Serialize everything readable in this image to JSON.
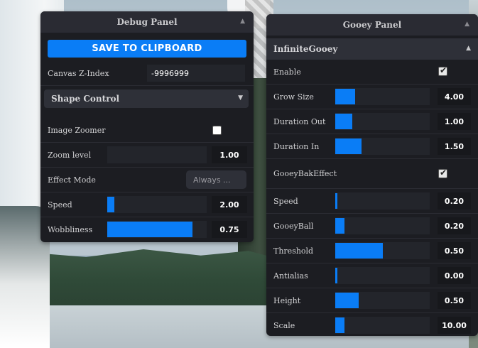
{
  "debug_panel": {
    "title": "Debug Panel",
    "collapse_icon": "chevron-up-icon",
    "save_button": "SAVE TO CLIPBOARD",
    "canvas_z_index": {
      "label": "Canvas Z-Index",
      "value": "-9996999"
    },
    "shape_control": {
      "label": "Shape Control",
      "icon": "chevron-down-icon"
    },
    "image_zoomer": {
      "label": "Image Zoomer",
      "checked": false
    },
    "zoom_level": {
      "label": "Zoom level",
      "value": "1.00",
      "fraction": 0
    },
    "effect_mode": {
      "label": "Effect Mode",
      "value": "Always ..."
    },
    "speed": {
      "label": "Speed",
      "value": "2.00",
      "fraction": 0.07
    },
    "wobbliness": {
      "label": "Wobbliness",
      "value": "0.75",
      "fraction": 0.86
    }
  },
  "gooey_panel": {
    "title": "Gooey Panel",
    "collapse_icon": "chevron-up-icon",
    "section": {
      "label": "InfiniteGooey",
      "icon": "chevron-up-icon"
    },
    "enable": {
      "label": "Enable",
      "checked": true
    },
    "grow_size": {
      "label": "Grow Size",
      "value": "4.00",
      "fraction": 0.21
    },
    "duration_out": {
      "label": "Duration Out",
      "value": "1.00",
      "fraction": 0.18
    },
    "duration_in": {
      "label": "Duration In",
      "value": "1.50",
      "fraction": 0.28
    },
    "gooey_bak_effect": {
      "label": "GooeyBakEffect",
      "checked": true
    },
    "speed": {
      "label": "Speed",
      "value": "0.20",
      "fraction": 0.02
    },
    "gooey_ball": {
      "label": "GooeyBall",
      "value": "0.20",
      "fraction": 0.1
    },
    "threshold": {
      "label": "Threshold",
      "value": "0.50",
      "fraction": 0.5
    },
    "antialias": {
      "label": "Antialias",
      "value": "0.00",
      "fraction": 0.02
    },
    "height": {
      "label": "Height",
      "value": "0.50",
      "fraction": 0.25
    },
    "scale": {
      "label": "Scale",
      "value": "10.00",
      "fraction": 0.1
    }
  },
  "colors": {
    "accent": "#0a7df6",
    "panel_bg": "#1c1d22",
    "header_bg": "#2a2b33"
  }
}
